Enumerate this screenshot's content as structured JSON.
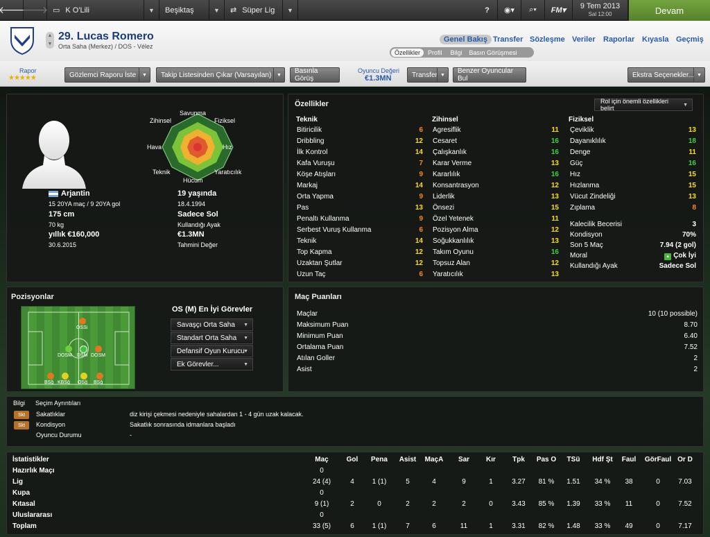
{
  "topbar": {
    "club1": "K O'Lili",
    "club2": "Beşiktaş",
    "league": "Süper Lig",
    "date": "9 Tem 2013",
    "time": "Sal 12:00",
    "continue": "Devam"
  },
  "player": {
    "name": "29. Lucas Romero",
    "role": "Orta Saha (Merkez) / DOS - Vélez"
  },
  "tabs": {
    "t1": "Genel Bakış",
    "t2": "Transfer",
    "t3": "Sözleşme",
    "t4": "Veriler",
    "t5": "Raporlar",
    "t6": "Kıyasla",
    "t7": "Geçmiş"
  },
  "subtabs": {
    "s1": "Özellikler",
    "s2": "Profil",
    "s3": "Bilgi",
    "s4": "Basın Görüşmesi"
  },
  "toolbar": {
    "rapor": "Rapor",
    "stars": "★★★★★",
    "b1": "Gözlemci Raporu İste",
    "b2": "Takip Listesinden Çıkar (Varsayılan)",
    "b3": "Basınla Görüş",
    "value_label": "Oyuncu Değeri",
    "value": "€1.3MN",
    "b4": "Transfer",
    "b5": "Benzer Oyuncular Bul",
    "b6": "Ekstra Seçenekler..."
  },
  "radar": {
    "l1": "Savunma",
    "l2": "Fiziksel",
    "l3": "Hız",
    "l4": "Yaratıcılık",
    "l5": "Hücum",
    "l6": "Teknik",
    "l7": "Hava",
    "l8": "Zihinsel"
  },
  "info": {
    "nation": "Arjantin",
    "caps": "15 20YA maç / 9 20YA gol",
    "age": "19 yaşında",
    "dob": "18.4.1994",
    "height": "175 cm",
    "foot": "Sadece Sol",
    "weight": "70 kg",
    "foot_label": "Kullandığı Ayak",
    "wage": "yıllık €160,000",
    "value": "€1.3MN",
    "contract": "30.6.2015",
    "value_label": "Tahmini Değer"
  },
  "attrs": {
    "title": "Özellikler",
    "role_btn": "Rol için önemli özellikleri belirt",
    "tech_h": "Teknik",
    "ment_h": "Zihinsel",
    "phys_h": "Fiziksel",
    "tech": [
      [
        "Bitiricilik",
        "6"
      ],
      [
        "Dribbling",
        "12"
      ],
      [
        "İlk Kontrol",
        "14"
      ],
      [
        "Kafa Vuruşu",
        "7"
      ],
      [
        "Köşe Atışları",
        "9"
      ],
      [
        "Markaj",
        "14"
      ],
      [
        "Orta Yapma",
        "9"
      ],
      [
        "Pas",
        "13"
      ],
      [
        "Penaltı Kullanma",
        "9"
      ],
      [
        "Serbest Vuruş Kullanma",
        "6"
      ],
      [
        "Teknik",
        "14"
      ],
      [
        "Top Kapma",
        "12"
      ],
      [
        "Uzaktan Şutlar",
        "12"
      ],
      [
        "Uzun Taç",
        "6"
      ]
    ],
    "ment": [
      [
        "Agresiflik",
        "11"
      ],
      [
        "Cesaret",
        "16"
      ],
      [
        "Çalışkanlık",
        "16"
      ],
      [
        "Karar Verme",
        "13"
      ],
      [
        "Kararlılık",
        "16"
      ],
      [
        "Konsantrasyon",
        "12"
      ],
      [
        "Liderlik",
        "13"
      ],
      [
        "Önsezi",
        "15"
      ],
      [
        "Özel Yetenek",
        "11"
      ],
      [
        "Pozisyon Alma",
        "12"
      ],
      [
        "Soğukkanlılık",
        "13"
      ],
      [
        "Takım Oyunu",
        "16"
      ],
      [
        "Topsuz Alan",
        "12"
      ],
      [
        "Yaratıcılık",
        "13"
      ]
    ],
    "phys": [
      [
        "Çeviklik",
        "13"
      ],
      [
        "Dayanıklılık",
        "18"
      ],
      [
        "Denge",
        "11"
      ],
      [
        "Güç",
        "16"
      ],
      [
        "Hız",
        "15"
      ],
      [
        "Hızlanma",
        "15"
      ],
      [
        "Vücut Zindeliği",
        "13"
      ],
      [
        "Zıplama",
        "8"
      ]
    ],
    "extra": [
      [
        "Kalecilik Becerisi",
        "3"
      ],
      [
        "Kondisyon",
        "70%"
      ],
      [
        "Son 5 Maç",
        "7.94 (2 gol)"
      ],
      [
        "Moral",
        "Çok İyi"
      ],
      [
        "Kullandığı Ayak",
        "Sadece Sol"
      ]
    ]
  },
  "positions": {
    "title": "Pozisyonlar",
    "best": "OS (M) En İyi Görevler",
    "r1": "Savaşçı Orta Saha",
    "r2": "Standart Orta Saha",
    "r3": "Defansif Oyun Kurucu",
    "r4": "Ek Görevler...",
    "p_ossi": "OSSi",
    "p_dosm_l": "DOSM",
    "p_dosm_c": "DSM",
    "p_dosm_r": "DOSM",
    "p_b1": "BSğ",
    "p_b2": "KBSğ",
    "p_b3": "OSğ",
    "p_b4": "BSğ"
  },
  "ratings": {
    "title": "Maç Puanları",
    "rows": [
      [
        "Maçlar",
        "10 (10 possible)"
      ],
      [
        "Maksimum Puan",
        "8.70"
      ],
      [
        "Minimum Puan",
        "6.40"
      ],
      [
        "Ortalama Puan",
        "7.52"
      ],
      [
        "Atılan Goller",
        "2"
      ],
      [
        "Asist",
        "2"
      ]
    ]
  },
  "injury": {
    "tab1": "Bilgi",
    "tab2": "Seçim Ayrıntıları",
    "b1": "Skt",
    "b2": "Skt",
    "r1l": "Sakatlıklar",
    "r1v": "diz kirişi çekmesi nedeniyle sahalardan 1 - 4 gün uzak kalacak.",
    "r2l": "Kondisyon",
    "r2v": "Sakatlık sonrasında idmanlara başladı",
    "r3l": "Oyuncu Durumu",
    "r3v": "-"
  },
  "stats": {
    "title": "İstatistikler",
    "headers": [
      "Maç",
      "Gol",
      "Pena",
      "Asist",
      "MaçA",
      "Sar",
      "Kır",
      "Tpk",
      "Pas O",
      "TSü",
      "Hdf Şt",
      "Faul",
      "GörFaul",
      "Or D"
    ],
    "rows": [
      [
        "Hazırlık Maçı",
        "0",
        "",
        "",
        "",
        "",
        "",
        "",
        "",
        "",
        "",
        "",
        "",
        "",
        ""
      ],
      [
        "Lig",
        "24 (4)",
        "4",
        "1 (1)",
        "5",
        "4",
        "9",
        "1",
        "3.27",
        "81 %",
        "1.51",
        "34 %",
        "38",
        "0",
        "7.03"
      ],
      [
        "Kupa",
        "0",
        "",
        "",
        "",
        "",
        "",
        "",
        "",
        "",
        "",
        "",
        "",
        "",
        ""
      ],
      [
        "Kıtasal",
        "9 (1)",
        "2",
        "0",
        "2",
        "2",
        "2",
        "0",
        "3.43",
        "85 %",
        "1.39",
        "33 %",
        "11",
        "0",
        "7.52"
      ],
      [
        "Uluslararası",
        "0",
        "",
        "",
        "",
        "",
        "",
        "",
        "",
        "",
        "",
        "",
        "",
        "",
        ""
      ],
      [
        "Toplam",
        "33 (5)",
        "6",
        "1 (1)",
        "7",
        "6",
        "11",
        "1",
        "3.31",
        "82 %",
        "1.48",
        "33 %",
        "49",
        "0",
        "7.17"
      ]
    ]
  }
}
